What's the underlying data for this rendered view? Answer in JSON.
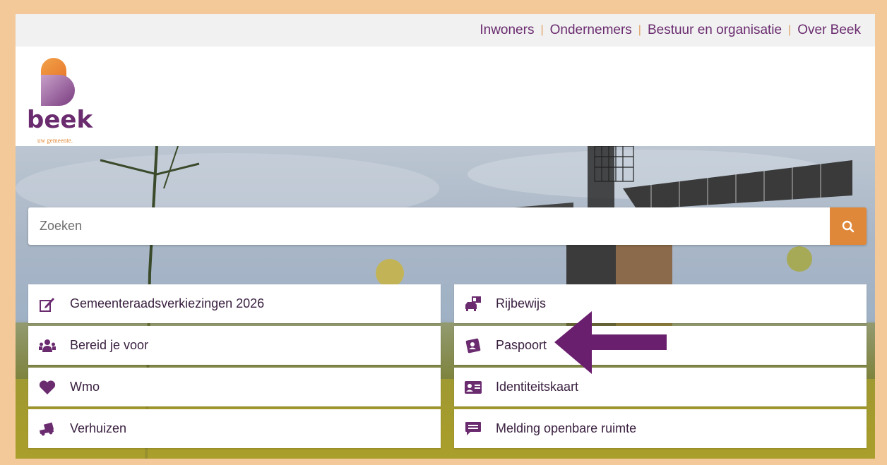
{
  "topnav": {
    "items": [
      "Inwoners",
      "Ondernemers",
      "Bestuur en organisatie",
      "Over Beek"
    ]
  },
  "logo": {
    "word": "beek",
    "tagline": "uw gemeente."
  },
  "search": {
    "placeholder": "Zoeken",
    "icon": "search-icon"
  },
  "tiles": {
    "left": [
      {
        "label": "Gemeenteraadsverkiezingen 2026",
        "icon": "pencil-ballot-icon"
      },
      {
        "label": "Bereid je voor",
        "icon": "people-icon"
      },
      {
        "label": "Wmo",
        "icon": "heart-icon"
      },
      {
        "label": "Verhuizen",
        "icon": "truck-icon"
      }
    ],
    "right": [
      {
        "label": "Rijbewijs",
        "icon": "car-license-icon"
      },
      {
        "label": "Paspoort",
        "icon": "passport-icon"
      },
      {
        "label": "Identiteitskaart",
        "icon": "id-card-icon"
      },
      {
        "label": "Melding openbare ruimte",
        "icon": "message-icon"
      }
    ]
  },
  "colors": {
    "brand_purple": "#6a2b6f",
    "accent_orange": "#e0883a",
    "frame": "#f3c99a",
    "arrow": "#6a1f6e"
  }
}
